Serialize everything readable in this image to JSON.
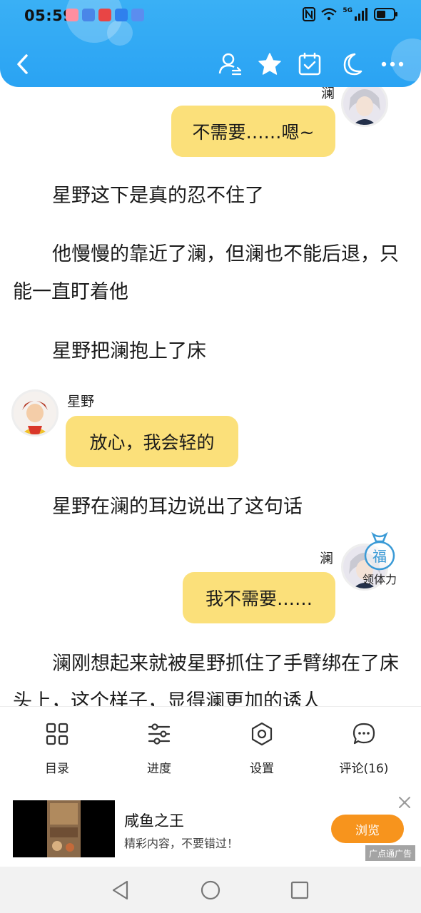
{
  "status_bar": {
    "time": "05:59",
    "network": "5G"
  },
  "header": {
    "back_icon": "chevron-left-icon",
    "icons": [
      "user-switch-icon",
      "star-icon",
      "calendar-check-icon",
      "moon-icon",
      "more-icon"
    ]
  },
  "story": {
    "messages": [
      {
        "type": "chat",
        "speaker": "澜",
        "side": "right",
        "text": "不需要……嗯~"
      },
      {
        "type": "narration",
        "text": "星野这下是真的忍不住了"
      },
      {
        "type": "narration",
        "text": "他慢慢的靠近了澜，但澜也不能后退，只能一直盯着他"
      },
      {
        "type": "narration",
        "text": "星野把澜抱上了床"
      },
      {
        "type": "chat",
        "speaker": "星野",
        "side": "left",
        "text": "放心，我会轻的"
      },
      {
        "type": "narration",
        "text": "星野在澜的耳边说出了这句话"
      },
      {
        "type": "chat",
        "speaker": "澜",
        "side": "right",
        "text": "我不需要……"
      },
      {
        "type": "narration",
        "text": "澜刚想起来就被星野抓住了手臂绑在了床头上，这个样子，显得澜更加的诱人"
      }
    ]
  },
  "floating_badge": {
    "glyph": "福",
    "label": "领体力"
  },
  "toolbar": {
    "items": [
      {
        "label": "目录",
        "icon": "grid-icon"
      },
      {
        "label": "进度",
        "icon": "sliders-icon"
      },
      {
        "label": "设置",
        "icon": "gear-icon"
      },
      {
        "label": "评论(16)",
        "icon": "comment-icon"
      }
    ]
  },
  "ad": {
    "title": "咸鱼之王",
    "subtitle": "精彩内容，不要错过！",
    "button": "浏览",
    "tag": "广点通广告"
  },
  "colors": {
    "header": "#2aa3f3",
    "chat_bubble": "#fbe07a",
    "ad_button": "#f7941d"
  }
}
